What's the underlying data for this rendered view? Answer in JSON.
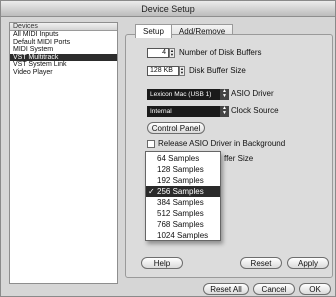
{
  "window": {
    "title": "Device Setup"
  },
  "sidebar": {
    "header": "Devices",
    "items": [
      {
        "label": "All MIDI Inputs",
        "selected": false
      },
      {
        "label": "Default MIDI Ports",
        "selected": false
      },
      {
        "label": "MIDI System",
        "selected": false
      },
      {
        "label": "VST Multitrack",
        "selected": true
      },
      {
        "label": "VST System Link",
        "selected": false
      },
      {
        "label": "Video Player",
        "selected": false
      }
    ]
  },
  "tabs": [
    {
      "label": "Setup",
      "active": true
    },
    {
      "label": "Add/Remove",
      "active": false
    }
  ],
  "setup": {
    "disk_buffers_value": "4",
    "disk_buffers_label": "Number of Disk Buffers",
    "buffer_size_value": "128 KB",
    "buffer_size_label": "Disk Buffer Size",
    "asio_driver_value": "Lexicon Mac (USB 1)",
    "asio_driver_label": "ASIO Driver",
    "clock_source_value": "Internal",
    "clock_source_label": "Clock Source",
    "control_panel_label": "Control Panel",
    "release_driver_label": "Release ASIO Driver in Background",
    "partial_label": "ffer Size"
  },
  "buffer_menu": {
    "options": [
      "64 Samples",
      "128 Samples",
      "192 Samples",
      "256 Samples",
      "384 Samples",
      "512 Samples",
      "768 Samples",
      "1024 Samples"
    ],
    "selected_index": 3,
    "check_glyph": "✓"
  },
  "buttons": {
    "help": "Help",
    "reset": "Reset",
    "apply": "Apply",
    "reset_all": "Reset All",
    "cancel": "Cancel",
    "ok": "OK"
  },
  "colors": {
    "selection": "#2a2a2a",
    "panel": "#dcdcdc"
  }
}
